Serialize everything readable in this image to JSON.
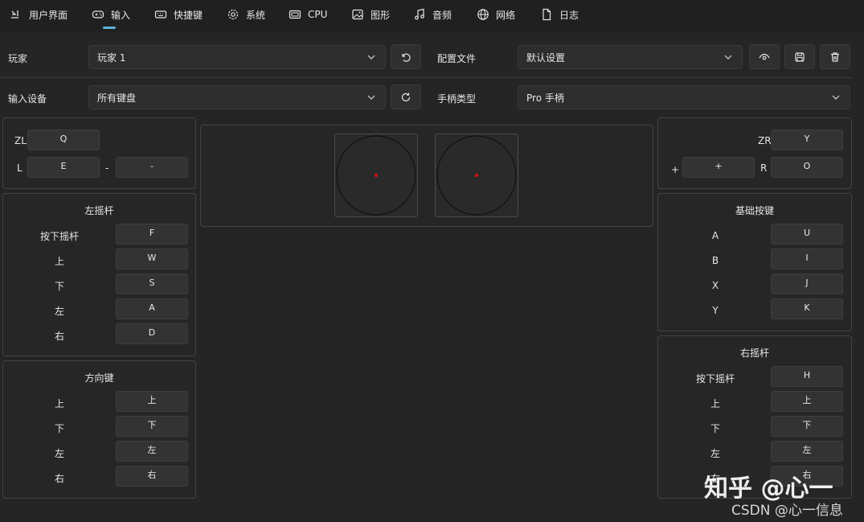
{
  "tabs": [
    {
      "label": "用户界面",
      "icon": "user-interface-icon"
    },
    {
      "label": "输入",
      "icon": "gamepad-icon",
      "active": true
    },
    {
      "label": "快捷键",
      "icon": "keyboard-icon"
    },
    {
      "label": "系统",
      "icon": "gear-icon"
    },
    {
      "label": "CPU",
      "icon": "cpu-icon"
    },
    {
      "label": "图形",
      "icon": "image-icon"
    },
    {
      "label": "音频",
      "icon": "music-icon"
    },
    {
      "label": "网络",
      "icon": "globe-icon"
    },
    {
      "label": "日志",
      "icon": "document-icon"
    }
  ],
  "player": {
    "label": "玩家",
    "value": "玩家 1"
  },
  "profile": {
    "label": "配置文件",
    "value": "默认设置"
  },
  "input_device": {
    "label": "输入设备",
    "value": "所有键盘"
  },
  "controller_type": {
    "label": "手柄类型",
    "value": "Pro 手柄"
  },
  "left_shoulder": {
    "zl_label": "ZL",
    "zl_key": "Q",
    "l_label": "L",
    "l_key": "E",
    "minus_label": "-",
    "minus_key": "-"
  },
  "left_stick": {
    "title": "左摇杆",
    "rows": [
      {
        "label": "按下摇杆",
        "key": "F"
      },
      {
        "label": "上",
        "key": "W"
      },
      {
        "label": "下",
        "key": "S"
      },
      {
        "label": "左",
        "key": "A"
      },
      {
        "label": "右",
        "key": "D"
      }
    ]
  },
  "dpad": {
    "title": "方向键",
    "rows": [
      {
        "label": "上",
        "key": "上"
      },
      {
        "label": "下",
        "key": "下"
      },
      {
        "label": "左",
        "key": "左"
      },
      {
        "label": "右",
        "key": "右"
      }
    ]
  },
  "right_shoulder": {
    "zr_label": "ZR",
    "zr_key": "Y",
    "plus_label": "+",
    "plus_key": "+",
    "r_label": "R",
    "r_key": "O"
  },
  "face_buttons": {
    "title": "基础按键",
    "rows": [
      {
        "label": "A",
        "key": "U"
      },
      {
        "label": "B",
        "key": "I"
      },
      {
        "label": "X",
        "key": "J"
      },
      {
        "label": "Y",
        "key": "K"
      }
    ]
  },
  "right_stick": {
    "title": "右摇杆",
    "rows": [
      {
        "label": "按下摇杆",
        "key": "H"
      },
      {
        "label": "上",
        "key": "上"
      },
      {
        "label": "下",
        "key": "下"
      },
      {
        "label": "左",
        "key": "左"
      },
      {
        "label": "右",
        "key": "右"
      }
    ]
  },
  "watermark": {
    "zhihu": "知乎 @心一",
    "csdn": "CSDN @心一信息"
  },
  "colors": {
    "accent": "#5fb0d8",
    "stick_dot": "#d01010"
  }
}
